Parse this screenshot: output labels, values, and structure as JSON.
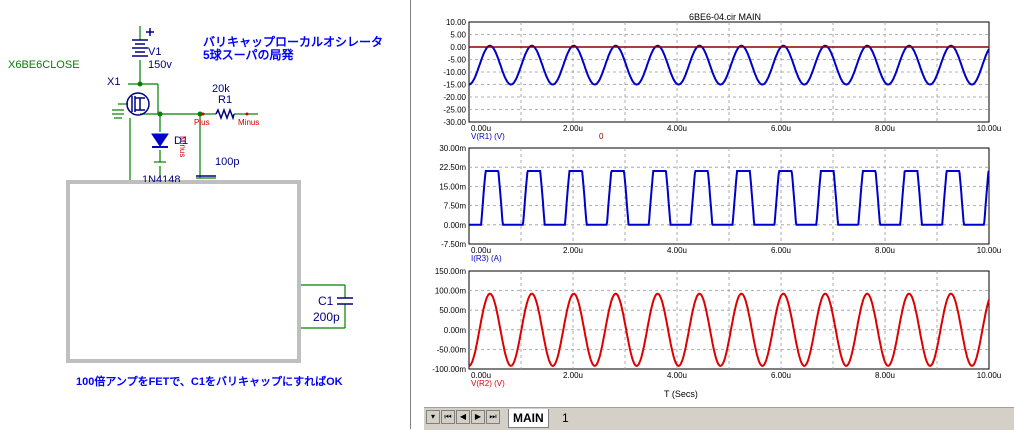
{
  "schematic": {
    "model_label": "X6BE6CLOSE",
    "title_line1": "バリキャップローカルオシレータ",
    "title_line2": "5球スーパの局発",
    "v1_name": "V1",
    "v1_value": "150v",
    "x1_name": "X1",
    "r1_name": "R1",
    "r1_value": "20k",
    "r1_plus": "Plus",
    "r1_minus": "Minus",
    "d1_name": "D1",
    "d1_minus": "Minus",
    "d1_model": "1N4148",
    "cap_value": "100p",
    "c1_name": "C1",
    "c1_value": "200p",
    "note": "100倍アンプをFETで、C1をバリキャップにすればOK",
    "colors": {
      "wire": "#008000",
      "label": "#000080",
      "title": "#0000ff",
      "node": "#cc0000",
      "frame": "#bfbfbf"
    }
  },
  "scope": {
    "title": "6BE6-04.cir MAIN",
    "x_axis_label": "T (Secs)",
    "tabs": [
      "MAIN",
      "1"
    ],
    "nav_icons": [
      "tab-menu-icon",
      "first-icon",
      "prev-icon",
      "next-icon",
      "last-icon"
    ]
  },
  "chart_data": [
    {
      "type": "line",
      "x_ticks": [
        "0.00u",
        "2.00u",
        "4.00u",
        "6.00u",
        "8.00u",
        "10.00u"
      ],
      "y_ticks": [
        "10.00",
        "5.00",
        "0.00",
        "-5.00",
        "-10.00",
        "-15.00",
        "-20.00",
        "-25.00",
        "-30.00"
      ],
      "ylim": [
        -30,
        10
      ],
      "xlim": [
        0,
        10
      ],
      "series": [
        {
          "name": "V(R1) (V)",
          "color": "#0000cc",
          "shape": "sine",
          "period_us": 0.806,
          "min": -15,
          "max": 0.5
        },
        {
          "name": "0",
          "color": "#8b0000",
          "shape": "constant",
          "value": 0
        }
      ]
    },
    {
      "type": "line",
      "x_ticks": [
        "0.00u",
        "2.00u",
        "4.00u",
        "6.00u",
        "8.00u",
        "10.00u"
      ],
      "y_ticks": [
        "30.00m",
        "22.50m",
        "15.00m",
        "7.50m",
        "0.00m",
        "-7.50m"
      ],
      "ylim": [
        -7.5,
        30
      ],
      "xlim": [
        0,
        10
      ],
      "series": [
        {
          "name": "I(R3) (A)",
          "color": "#0000cc",
          "shape": "clipped-sine",
          "period_us": 0.806,
          "max": 21,
          "min": 0
        }
      ]
    },
    {
      "type": "line",
      "x_ticks": [
        "0.00u",
        "2.00u",
        "4.00u",
        "6.00u",
        "8.00u",
        "10.00u"
      ],
      "y_ticks": [
        "150.00m",
        "100.00m",
        "50.00m",
        "0.00m",
        "-50.00m",
        "-100.00m"
      ],
      "ylim": [
        -100,
        150
      ],
      "xlim": [
        0,
        10
      ],
      "series": [
        {
          "name": "V(R2) (V)",
          "color": "#dd0000",
          "shape": "sine",
          "period_us": 0.806,
          "min": -92,
          "max": 92
        }
      ]
    }
  ]
}
